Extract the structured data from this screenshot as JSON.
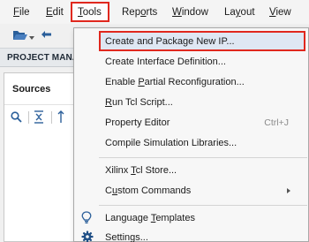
{
  "menubar": {
    "items": [
      {
        "label": "File",
        "u": "F",
        "rest": "ile"
      },
      {
        "label": "Edit",
        "u": "E",
        "rest": "dit"
      },
      {
        "label": "Tools",
        "u": "T",
        "rest": "ools"
      },
      {
        "label": "Reports",
        "pre": "Rep",
        "u": "o",
        "rest": "rts"
      },
      {
        "label": "Window",
        "u": "W",
        "rest": "indow"
      },
      {
        "label": "Layout",
        "pre": "La",
        "u": "y",
        "rest": "out"
      },
      {
        "label": "View",
        "u": "V",
        "rest": "iew"
      }
    ]
  },
  "panel": {
    "project_manager_title": "PROJECT MANA",
    "sources_title": "Sources"
  },
  "tools_menu": {
    "items": [
      {
        "id": "create-package-ip",
        "label": "Create and Package New IP..."
      },
      {
        "id": "create-interface-def",
        "label": "Create Interface Definition..."
      },
      {
        "id": "enable-partial-reconfig",
        "pre": "Enable ",
        "u": "P",
        "rest": "artial Reconfiguration..."
      },
      {
        "id": "run-tcl-script",
        "pre": "",
        "u": "R",
        "rest": "un Tcl Script..."
      },
      {
        "id": "property-editor",
        "label": "Property Editor",
        "shortcut": "Ctrl+J"
      },
      {
        "id": "compile-sim-libs",
        "label": "Compile Simulation Libraries..."
      },
      {
        "id": "xilinx-tcl-store",
        "pre": "Xilinx ",
        "u": "T",
        "rest": "cl Store..."
      },
      {
        "id": "custom-commands",
        "pre": "C",
        "u": "u",
        "rest": "stom Commands"
      },
      {
        "id": "language-templates",
        "pre": "Language ",
        "u": "T",
        "rest": "emplates"
      },
      {
        "id": "settings",
        "label": "Settings..."
      }
    ]
  },
  "colors": {
    "highlight_border": "#e0281e",
    "highlight_fill": "#dfe7f3",
    "icon_blue": "#2b5f9a"
  }
}
